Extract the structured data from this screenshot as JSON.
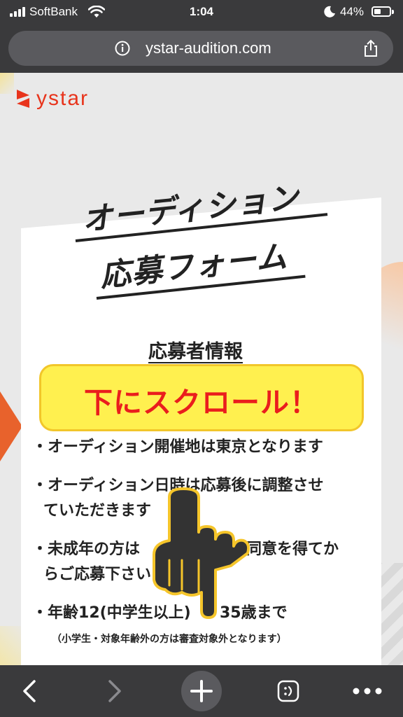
{
  "status_bar": {
    "carrier": "SoftBank",
    "time": "1:04",
    "battery": "44%"
  },
  "browser": {
    "url": "ystar-audition.com"
  },
  "page": {
    "logo_text": "ystar",
    "title_line1": "オーディション",
    "title_line2": "応募フォーム",
    "section_heading": "応募者情報",
    "banner_text": "下にスクロール！",
    "bullets": [
      "オーディション開催地は東京となります",
      "オーディション日時は応募後に調整させ",
      "ていただきます",
      "未成年の方は",
      "の同意を得てか",
      "らご応募下さい",
      "年齢12(中学生以上)",
      "35歳まで"
    ],
    "note": "（小学生・対象年齢外の方は審査対象外となります）"
  },
  "colors": {
    "brand": "#e8341c",
    "banner_bg": "#fff04f",
    "banner_text": "#ea1d1d",
    "hand_outline": "#f5c52a"
  }
}
